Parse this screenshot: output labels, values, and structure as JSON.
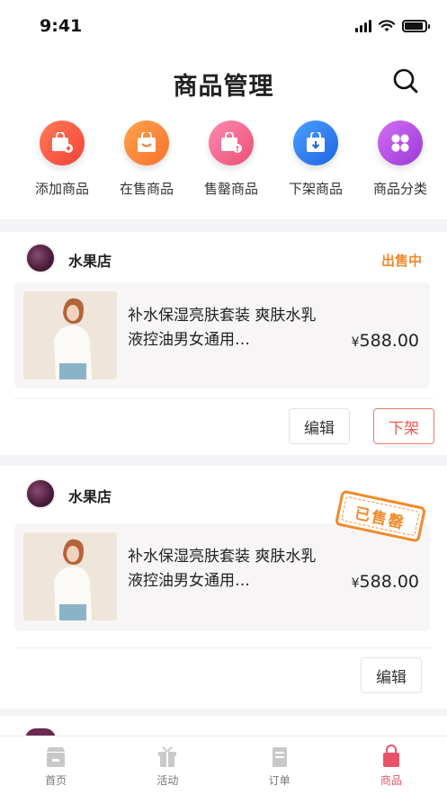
{
  "status": {
    "time": "9:41"
  },
  "header": {
    "title": "商品管理",
    "search_icon": "search-icon"
  },
  "quick_menu": [
    {
      "label": "添加商品",
      "icon": "add-bag-icon",
      "color": "#f4563f"
    },
    {
      "label": "在售商品",
      "icon": "smile-bag-icon",
      "color": "#f7823a"
    },
    {
      "label": "售罄商品",
      "icon": "alert-bag-icon",
      "color": "#ee5c82"
    },
    {
      "label": "下架商品",
      "icon": "down-bag-icon",
      "color": "#2f7cf0"
    },
    {
      "label": "商品分类",
      "icon": "grid-icon",
      "color": "#b54ae2"
    }
  ],
  "cards": [
    {
      "shop_name": "水果店",
      "status": "出售中",
      "product_title": "补水保湿亮肤套装 爽肤水乳液控油男女通用…",
      "currency": "¥",
      "price": "588.00",
      "buttons": [
        "编辑",
        "下架"
      ]
    },
    {
      "shop_name": "水果店",
      "stamp": "已售罄",
      "product_title": "补水保湿亮肤套装 爽肤水乳液控油男女通用…",
      "currency": "¥",
      "price": "588.00",
      "buttons": [
        "编辑"
      ]
    }
  ],
  "tabbar": {
    "items": [
      {
        "label": "首页",
        "icon": "shop-icon"
      },
      {
        "label": "活动",
        "icon": "gift-icon"
      },
      {
        "label": "订单",
        "icon": "order-icon"
      },
      {
        "label": "商品",
        "icon": "bag-icon",
        "active": true
      }
    ],
    "active_color": "#e9536a"
  }
}
